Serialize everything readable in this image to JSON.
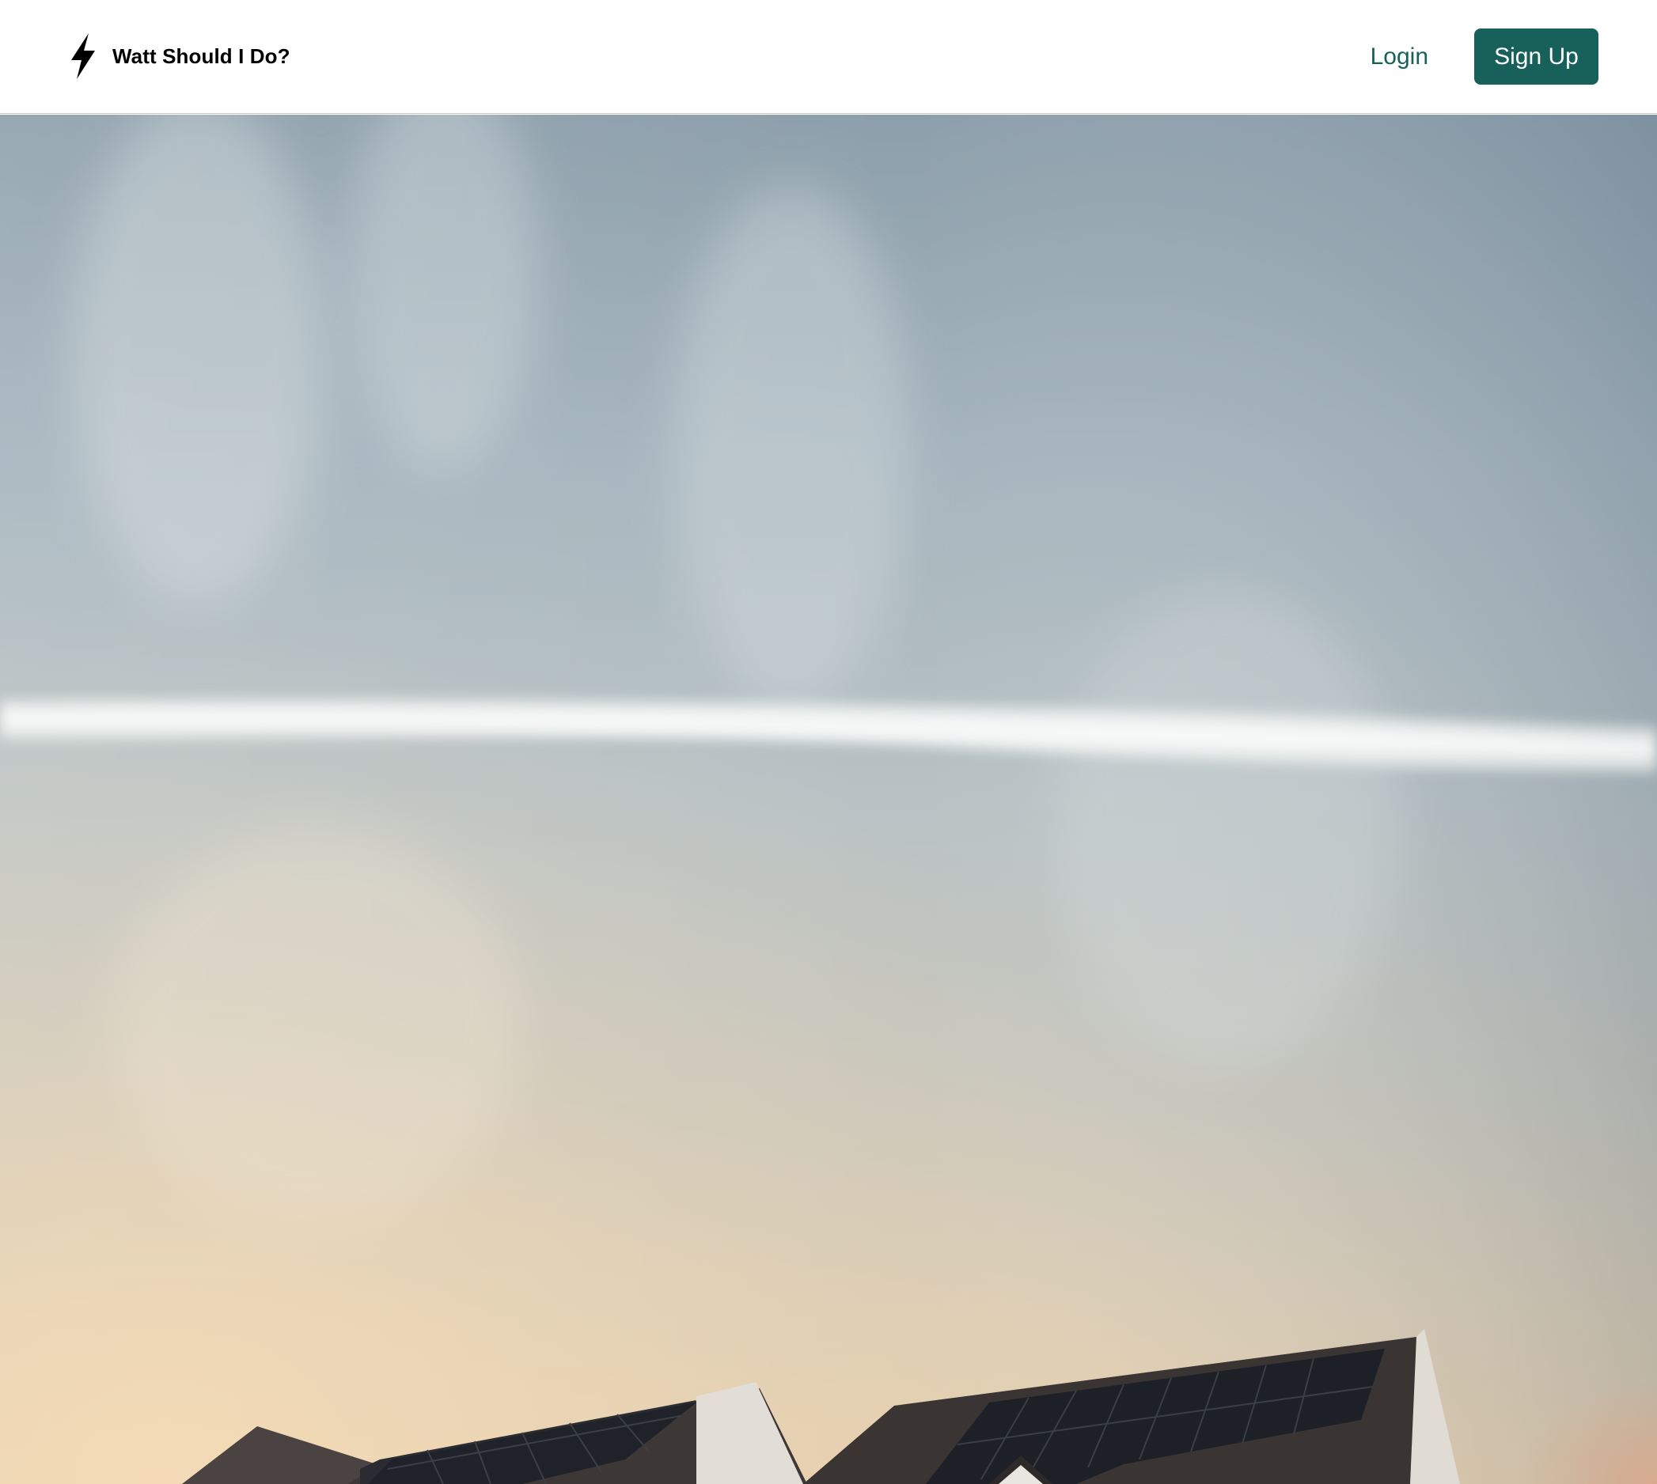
{
  "header": {
    "brand_name": "Watt Should I Do?",
    "brand_icon": "lightning-bolt-icon",
    "login_label": "Login",
    "signup_label": "Sign Up"
  },
  "colors": {
    "accent": "#18605a",
    "nav_background": "#ffffff",
    "brand_text": "#000000"
  },
  "hero": {
    "image_subject": "sunset sky with contrail over house rooftops with solar panels"
  }
}
